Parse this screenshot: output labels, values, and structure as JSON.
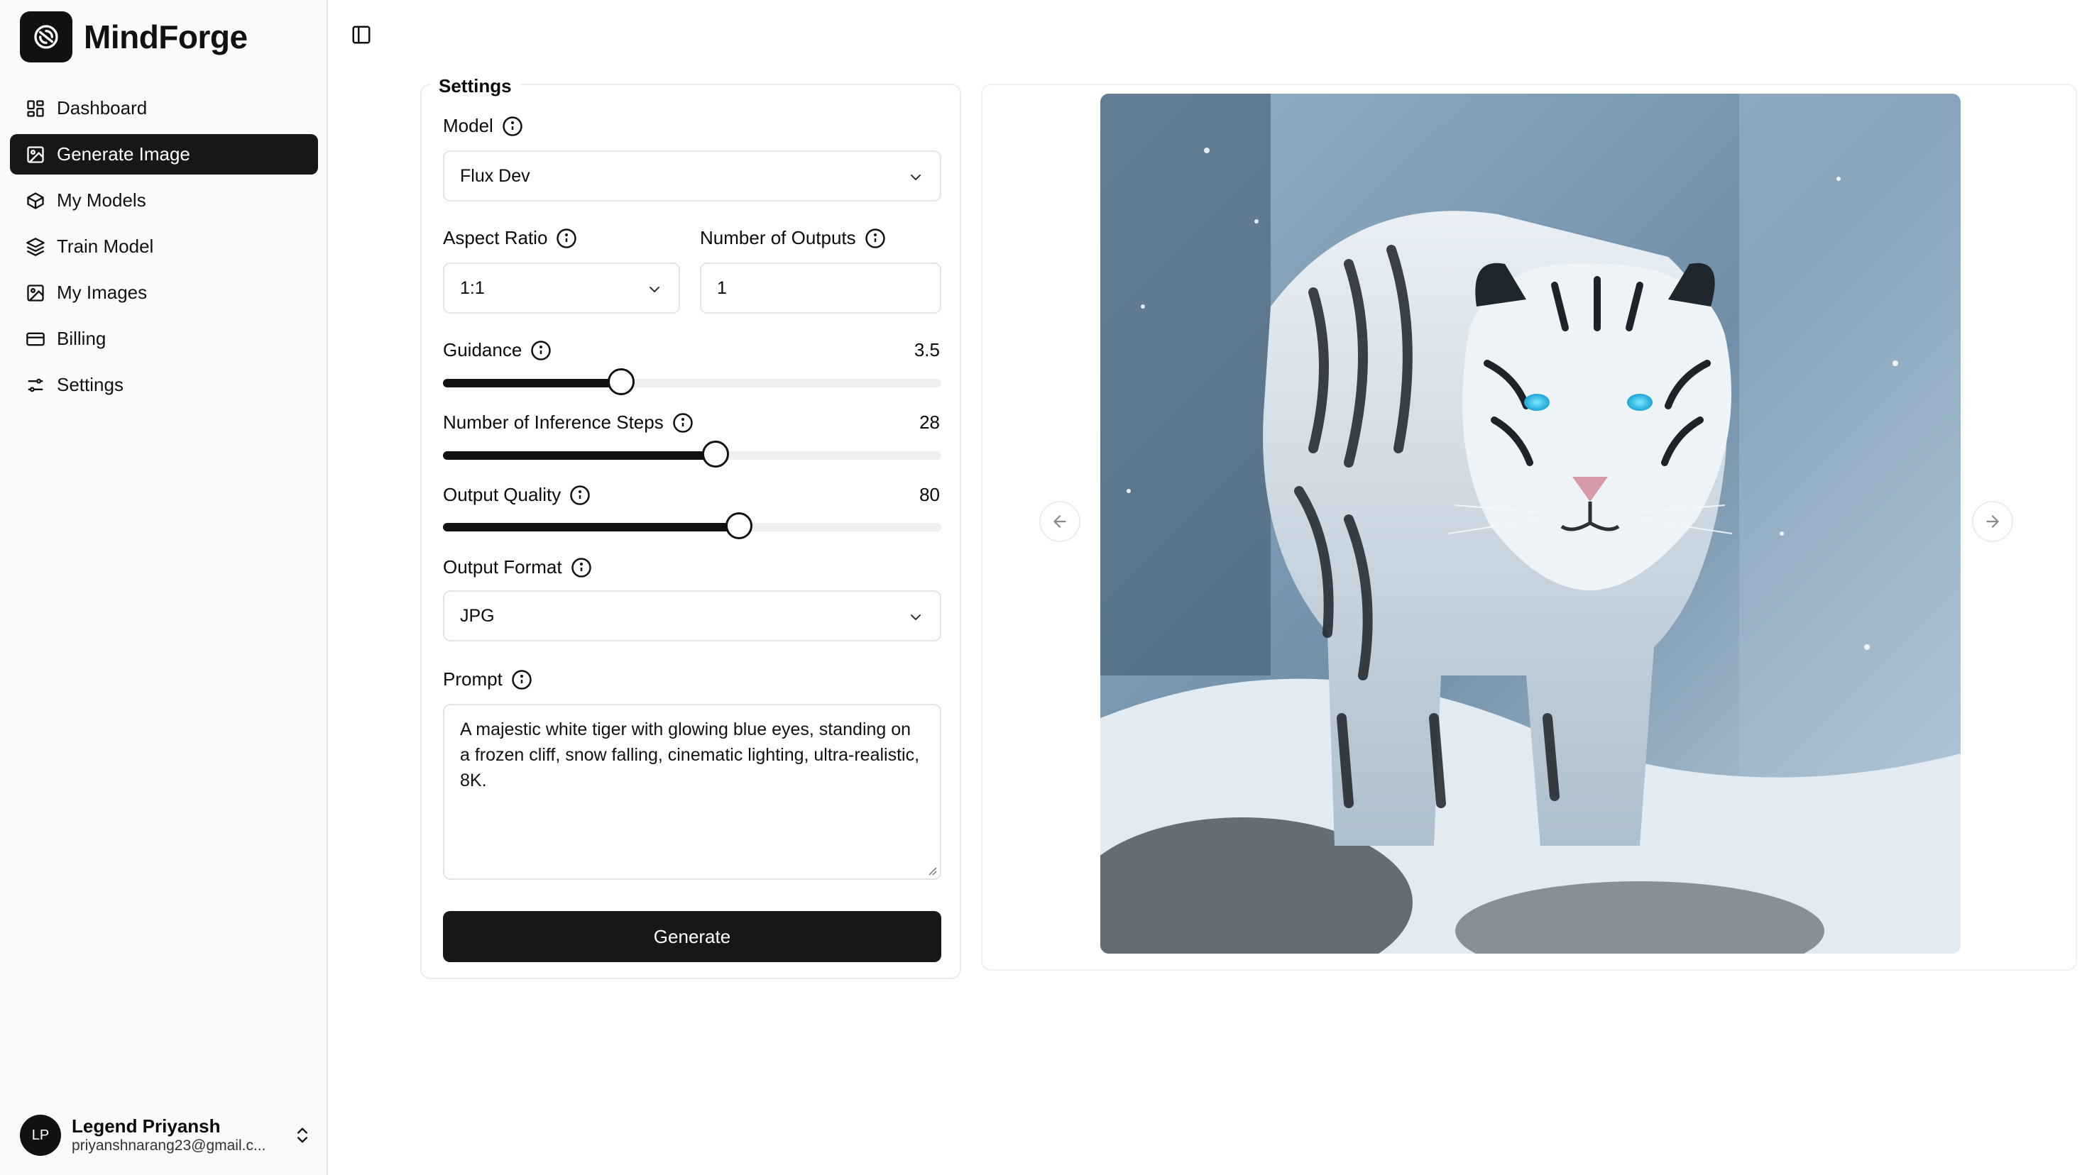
{
  "brand": {
    "name": "MindForge"
  },
  "sidebar": {
    "items": [
      {
        "label": "Dashboard",
        "icon": "dashboard-icon"
      },
      {
        "label": "Generate Image",
        "icon": "image-icon",
        "active": true
      },
      {
        "label": "My Models",
        "icon": "box-icon"
      },
      {
        "label": "Train Model",
        "icon": "layers-icon"
      },
      {
        "label": "My Images",
        "icon": "images-icon"
      },
      {
        "label": "Billing",
        "icon": "credit-card-icon"
      },
      {
        "label": "Settings",
        "icon": "sliders-icon"
      }
    ]
  },
  "user": {
    "initials": "LP",
    "name": "Legend Priyansh",
    "email": "priyanshnarang23@gmail.c..."
  },
  "settings": {
    "title": "Settings",
    "model": {
      "label": "Model",
      "value": "Flux Dev"
    },
    "aspect_ratio": {
      "label": "Aspect Ratio",
      "value": "1:1"
    },
    "num_outputs": {
      "label": "Number of Outputs",
      "value": "1"
    },
    "guidance": {
      "label": "Guidance",
      "value": "3.5",
      "fraction": 0.357
    },
    "inference_steps": {
      "label": "Number of Inference Steps",
      "value": "28",
      "fraction": 0.547
    },
    "output_quality": {
      "label": "Output Quality",
      "value": "80",
      "fraction": 0.594
    },
    "output_format": {
      "label": "Output Format",
      "value": "JPG"
    },
    "prompt": {
      "label": "Prompt",
      "value": "A majestic white tiger with glowing blue eyes, standing on a frozen cliff, snow falling, cinematic lighting, ultra-realistic, 8K."
    },
    "generate_label": "Generate"
  },
  "colors": {
    "accent": "#171717",
    "sidebar_bg": "#fafafa",
    "border": "#e5e5e5"
  }
}
